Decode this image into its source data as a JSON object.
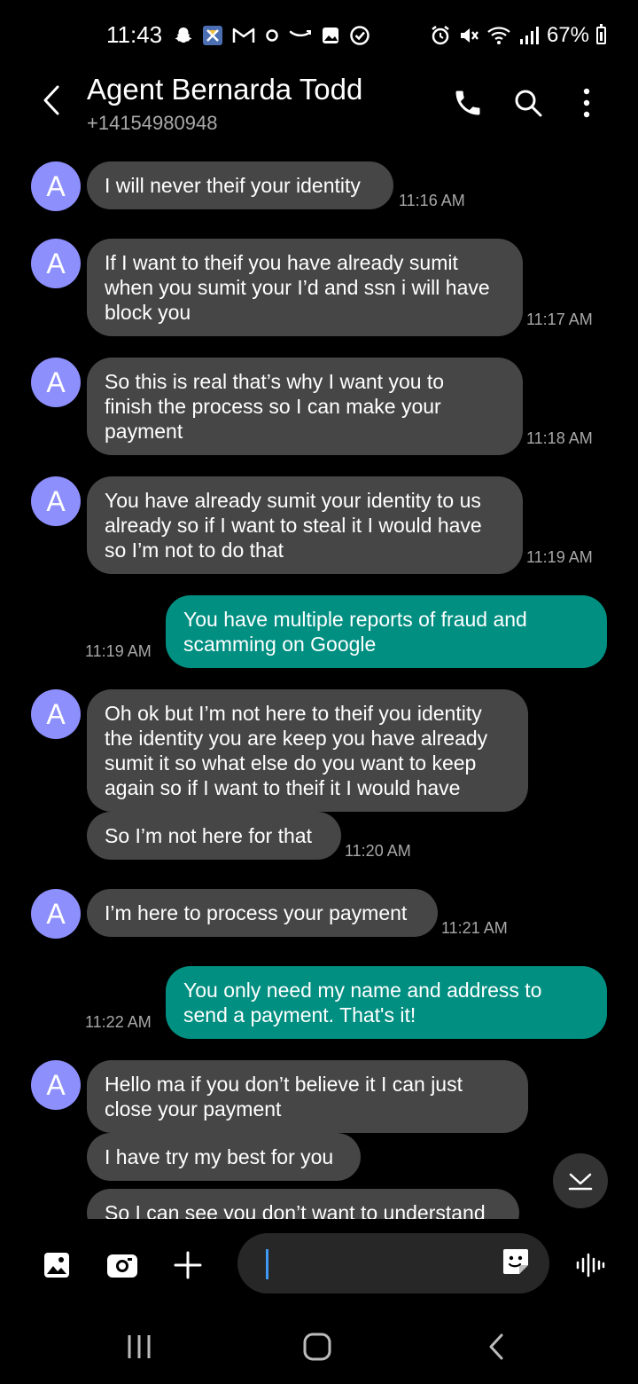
{
  "status_bar": {
    "time": "11:43",
    "battery": "67%",
    "icons_left": [
      "snapchat-icon",
      "app-icon",
      "gmail-icon",
      "dot-icon",
      "amazon-icon",
      "gallery-icon",
      "check-icon"
    ],
    "icons_right": [
      "alarm-icon",
      "mute-icon",
      "wifi-icon",
      "signal-icon",
      "battery-icon"
    ]
  },
  "header": {
    "contact_name": "Agent Bernarda Todd",
    "contact_number": "+14154980948",
    "icons": [
      "back-icon",
      "phone-icon",
      "search-icon",
      "more-icon"
    ]
  },
  "avatar_letter": "A",
  "messages": [
    {
      "dir": "in",
      "lines": [
        "I will never theif your identity"
      ],
      "time": "11:16 AM"
    },
    {
      "dir": "in",
      "lines": [
        "If I want to theif you have already sumit",
        "when you sumit your I’d and ssn i will have",
        "block you"
      ],
      "time": "11:17 AM"
    },
    {
      "dir": "in",
      "lines": [
        "So this is real that’s why I want you to",
        "finish the process so I can make your",
        "payment"
      ],
      "time": "11:18 AM"
    },
    {
      "dir": "in",
      "lines": [
        "You have already sumit your identity to us",
        "already so if I want to steal it I would have",
        "so I’m not to do that"
      ],
      "time": "11:19 AM"
    },
    {
      "dir": "out",
      "lines": [
        "You have multiple reports of fraud and",
        "scamming on Google"
      ],
      "time": "11:19 AM"
    },
    {
      "dir": "in",
      "lines": [
        "Oh ok but I’m not here to theif you identity",
        "the identity you are keep you have already",
        "sumit it so what else do you want to keep",
        "again so if I want to theif it I would have"
      ],
      "time": ""
    },
    {
      "dir": "in",
      "lines": [
        "So I’m not here for that"
      ],
      "time": "11:20 AM"
    },
    {
      "dir": "in",
      "lines": [
        "I’m here to process your payment"
      ],
      "time": "11:21 AM"
    },
    {
      "dir": "out",
      "lines": [
        "You only need my name and address to",
        "send a payment.  That's it!"
      ],
      "time": "11:22 AM"
    },
    {
      "dir": "in",
      "lines": [
        "Hello ma if you don’t believe it I can just",
        "close your payment"
      ],
      "time": ""
    },
    {
      "dir": "in",
      "lines": [
        "I have try my best for you"
      ],
      "time": ""
    },
    {
      "dir": "in",
      "lines": [
        "So I can see you don’t want to understand"
      ],
      "time": ""
    }
  ],
  "input_bar": {
    "message_value": "",
    "icons": [
      "gallery-icon",
      "camera-icon",
      "plus-icon",
      "sticker-icon",
      "voice-icon"
    ]
  },
  "colors": {
    "incoming_bubble": "#464646",
    "outgoing_bubble": "#008f81",
    "avatar": "#8d8ffc",
    "background": "#000000"
  }
}
